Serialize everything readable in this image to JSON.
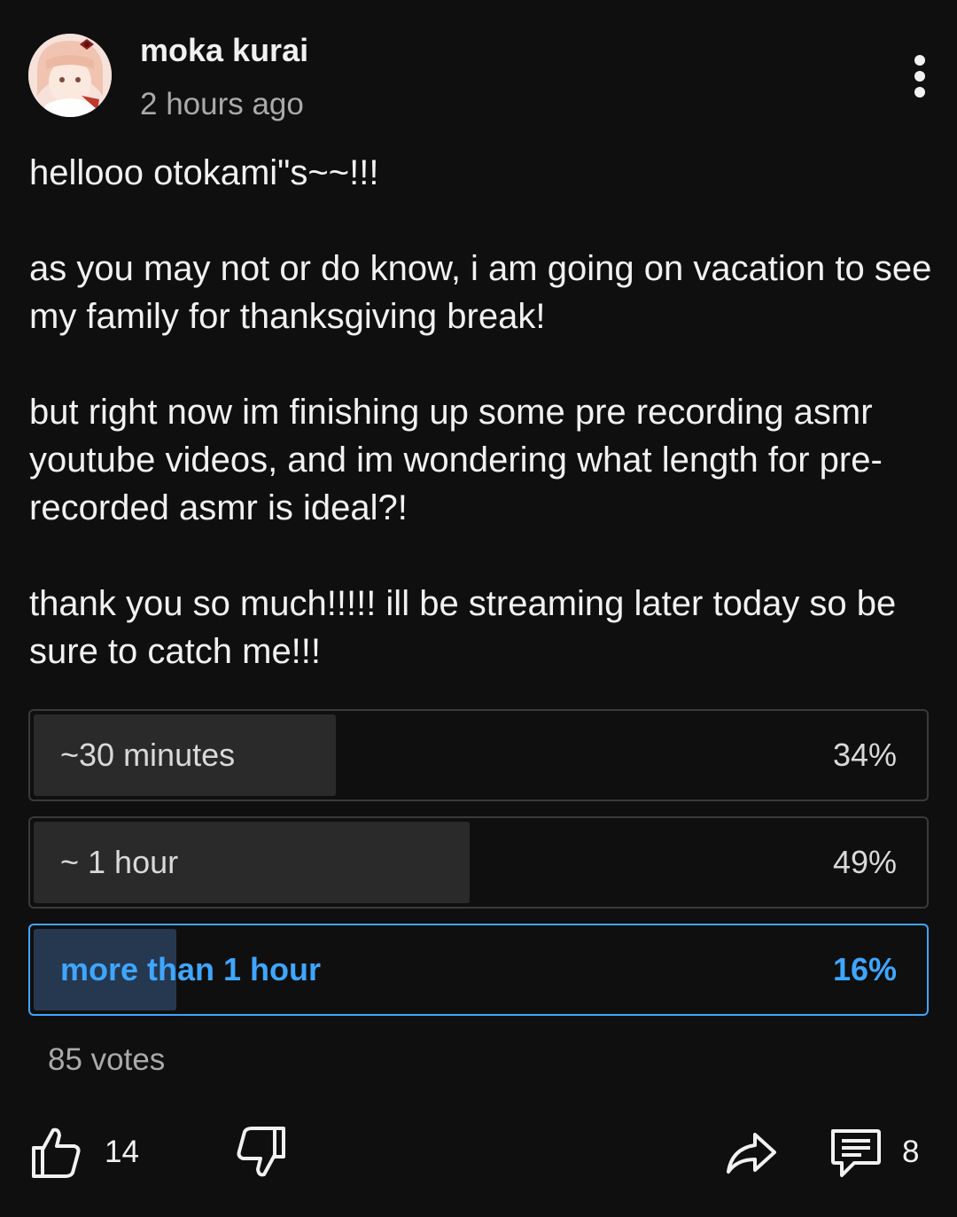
{
  "post": {
    "author": "moka kurai",
    "timestamp": "2 hours ago",
    "paragraphs": [
      "hellooo otokami\"s~~!!!",
      "as you may not or do know, i am going on vacation to see my family for thanksgiving break!",
      "but right now im finishing up some pre recording asmr youtube videos, and im wondering what length for pre-recorded asmr is ideal?!",
      "thank you so much!!!!! ill be streaming later today so be sure to catch me!!!"
    ]
  },
  "poll": {
    "options": [
      {
        "label": "~30 minutes",
        "percent_text": "34%",
        "fraction": 0.34,
        "selected": false
      },
      {
        "label": "~ 1 hour",
        "percent_text": "49%",
        "fraction": 0.49,
        "selected": false
      },
      {
        "label": "more than 1 hour",
        "percent_text": "16%",
        "fraction": 0.16,
        "selected": true
      }
    ],
    "votes": "85 votes"
  },
  "actions": {
    "like_count": "14",
    "comment_count": "8"
  },
  "icons": {
    "menu": "more-vertical-icon",
    "like": "thumbs-up-icon",
    "dislike": "thumbs-down-icon",
    "share": "share-icon",
    "comment": "comment-icon"
  },
  "colors": {
    "background": "#0f0f0f",
    "accent": "#3ea6ff",
    "secondary_text": "#aaaaaa"
  }
}
